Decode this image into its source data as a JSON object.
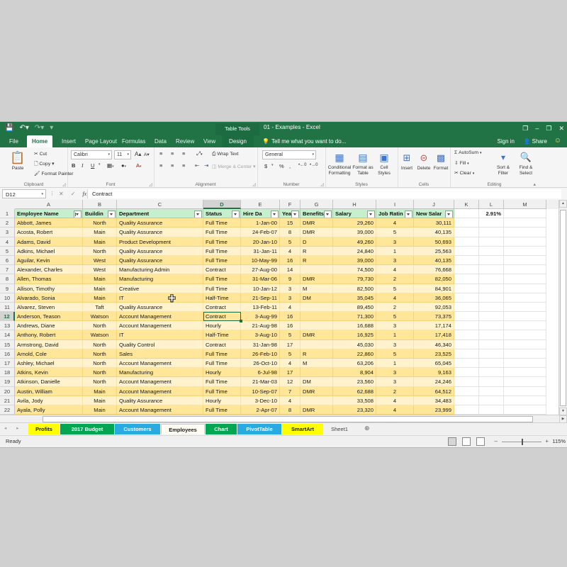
{
  "window": {
    "title": "01 - Examples - Excel",
    "context_tab_group": "Table Tools",
    "quick_access": [
      "save-icon",
      "undo-icon",
      "redo-icon",
      "customize-icon"
    ],
    "buttons": {
      "ribbon_display": "❐",
      "minimize": "–",
      "restore": "❐",
      "close": "✕"
    }
  },
  "ribbon": {
    "tabs": [
      "File",
      "Home",
      "Insert",
      "Page Layout",
      "Formulas",
      "Data",
      "Review",
      "View"
    ],
    "context_tab": "Design",
    "active_tab": "Home",
    "tell_me": "Tell me what you want to do...",
    "sign_in": "Sign in",
    "share": "Share",
    "groups": {
      "clipboard": {
        "label": "Clipboard",
        "paste": "Paste",
        "cut": "Cut",
        "copy": "Copy",
        "format_painter": "Format Painter"
      },
      "font": {
        "label": "Font",
        "font_name": "Calibri",
        "font_size": "11",
        "grow": "A",
        "shrink": "A",
        "bold": "B",
        "italic": "I",
        "underline": "U"
      },
      "alignment": {
        "label": "Alignment",
        "wrap_text": "Wrap Text",
        "merge_center": "Merge & Center"
      },
      "number": {
        "label": "Number",
        "format": "General",
        "currency": "$",
        "percent": "%",
        "comma": ","
      },
      "styles": {
        "label": "Styles",
        "conditional_formatting": "Conditional Formatting",
        "format_as_table": "Format as Table",
        "cell_styles": "Cell Styles"
      },
      "cells": {
        "label": "Cells",
        "insert": "Insert",
        "delete": "Delete",
        "format": "Format"
      },
      "editing": {
        "label": "Editing",
        "autosum": "AutoSum",
        "fill": "Fill",
        "clear": "Clear",
        "sort_filter": "Sort & Filter",
        "find_select": "Find & Select"
      }
    }
  },
  "formula_bar": {
    "name_box": "D12",
    "formula": "Contract",
    "cancel_icon": "✕",
    "enter_icon": "✓",
    "function_icon": "fx"
  },
  "grid": {
    "columns": [
      "A",
      "B",
      "C",
      "D",
      "E",
      "F",
      "G",
      "H",
      "I",
      "J",
      "K",
      "L",
      "M"
    ],
    "selected_column": "D",
    "selected_row": 12,
    "active_cell": "D12",
    "row_numbers": [
      1,
      2,
      3,
      4,
      5,
      6,
      7,
      8,
      9,
      10,
      11,
      12,
      13,
      14,
      15,
      16,
      17,
      18,
      19,
      20,
      21,
      22
    ],
    "headers": [
      "Employee Name",
      "Buildin",
      "Department",
      "Status",
      "Hire Da",
      "Yea",
      "Benefits",
      "Salary",
      "Job Ratin",
      "New Salar"
    ],
    "extra_cells": {
      "L1": "2.91%"
    },
    "rows": [
      [
        "Abbott, James",
        "North",
        "Quality Assurance",
        "Full Time",
        "1-Jan-00",
        "15",
        "DMR",
        "29,260",
        "4",
        "30,111"
      ],
      [
        "Acosta, Robert",
        "Main",
        "Quality Assurance",
        "Full Time",
        "24-Feb-07",
        "8",
        "DMR",
        "39,000",
        "5",
        "40,135"
      ],
      [
        "Adams, David",
        "Main",
        "Product Development",
        "Full Time",
        "20-Jan-10",
        "5",
        "D",
        "49,260",
        "3",
        "50,693"
      ],
      [
        "Adkins, Michael",
        "North",
        "Quality Assurance",
        "Full Time",
        "31-Jan-11",
        "4",
        "R",
        "24,840",
        "1",
        "25,563"
      ],
      [
        "Aguilar, Kevin",
        "West",
        "Quality Assurance",
        "Full Time",
        "10-May-99",
        "16",
        "R",
        "39,000",
        "3",
        "40,135"
      ],
      [
        "Alexander, Charles",
        "West",
        "Manufacturing Admin",
        "Contract",
        "27-Aug-00",
        "14",
        "",
        "74,500",
        "4",
        "76,668"
      ],
      [
        "Allen, Thomas",
        "Main",
        "Manufacturing",
        "Full Time",
        "31-Mar-06",
        "9",
        "DMR",
        "79,730",
        "2",
        "82,050"
      ],
      [
        "Allison, Timothy",
        "Main",
        "Creative",
        "Full Time",
        "10-Jan-12",
        "3",
        "M",
        "82,500",
        "5",
        "84,901"
      ],
      [
        "Alvarado, Sonia",
        "Main",
        "IT",
        "Half-Time",
        "21-Sep-11",
        "3",
        "DM",
        "35,045",
        "4",
        "36,065"
      ],
      [
        "Alvarez, Steven",
        "Taft",
        "Quality Assurance",
        "Contract",
        "13-Feb-11",
        "4",
        "",
        "89,450",
        "2",
        "92,053"
      ],
      [
        "Anderson, Teason",
        "Watson",
        "Account Management",
        "Contract",
        "3-Aug-99",
        "16",
        "",
        "71,300",
        "5",
        "73,375"
      ],
      [
        "Andrews, Diane",
        "North",
        "Account Management",
        "Hourly",
        "21-Aug-98",
        "16",
        "",
        "16,688",
        "3",
        "17,174"
      ],
      [
        "Anthony, Robert",
        "Watson",
        "IT",
        "Half-Time",
        "3-Aug-10",
        "5",
        "DMR",
        "16,925",
        "1",
        "17,418"
      ],
      [
        "Armstrong, David",
        "North",
        "Quality Control",
        "Contract",
        "31-Jan-98",
        "17",
        "",
        "45,030",
        "3",
        "46,340"
      ],
      [
        "Arnold, Cole",
        "North",
        "Sales",
        "Full Time",
        "26-Feb-10",
        "5",
        "R",
        "22,860",
        "5",
        "23,525"
      ],
      [
        "Ashley, Michael",
        "North",
        "Account Management",
        "Full Time",
        "26-Oct-10",
        "4",
        "M",
        "63,206",
        "1",
        "65,045"
      ],
      [
        "Atkins, Kevin",
        "North",
        "Manufacturing",
        "Hourly",
        "6-Jul-98",
        "17",
        "",
        "8,904",
        "3",
        "9,163"
      ],
      [
        "Atkinson, Danielle",
        "North",
        "Account Management",
        "Full Time",
        "21-Mar-03",
        "12",
        "DM",
        "23,560",
        "3",
        "24,246"
      ],
      [
        "Austin, William",
        "Main",
        "Account Management",
        "Full Time",
        "10-Sep-07",
        "7",
        "DMR",
        "62,688",
        "2",
        "64,512"
      ],
      [
        "Avila, Jody",
        "Main",
        "Quality Assurance",
        "Hourly",
        "3-Dec-10",
        "4",
        "",
        "33,508",
        "4",
        "34,483"
      ],
      [
        "Ayala, Polly",
        "Main",
        "Account Management",
        "Full Time",
        "2-Apr-07",
        "8",
        "DMR",
        "23,320",
        "4",
        "23,999"
      ]
    ]
  },
  "sheet_tabs": {
    "items": [
      {
        "label": "Profits",
        "color": "#ffff00",
        "text": "#1a1a1a",
        "active": false
      },
      {
        "label": "2017 Budget",
        "color": "#00a651",
        "text": "#ffffff",
        "active": false
      },
      {
        "label": "Customers",
        "color": "#29abe2",
        "text": "#ffffff",
        "active": false
      },
      {
        "label": "Employees",
        "color": "#fffdf3",
        "text": "#1a1a1a",
        "active": true
      },
      {
        "label": "Chart",
        "color": "#00a651",
        "text": "#ffffff",
        "active": false
      },
      {
        "label": "PivotTable",
        "color": "#29abe2",
        "text": "#ffffff",
        "active": false
      },
      {
        "label": "SmartArt",
        "color": "#ffff00",
        "text": "#1a1a1a",
        "active": false
      },
      {
        "label": "Sheet1",
        "color": "#f0f0f0",
        "text": "#444444",
        "active": false
      }
    ],
    "add_sheet": "⊕",
    "nav_prev": "◂",
    "nav_next": "▸"
  },
  "status_bar": {
    "status": "Ready",
    "zoom": "115%",
    "zoom_out": "–",
    "zoom_in": "+",
    "views": [
      "normal-view",
      "page-layout-view",
      "page-break-view"
    ]
  }
}
